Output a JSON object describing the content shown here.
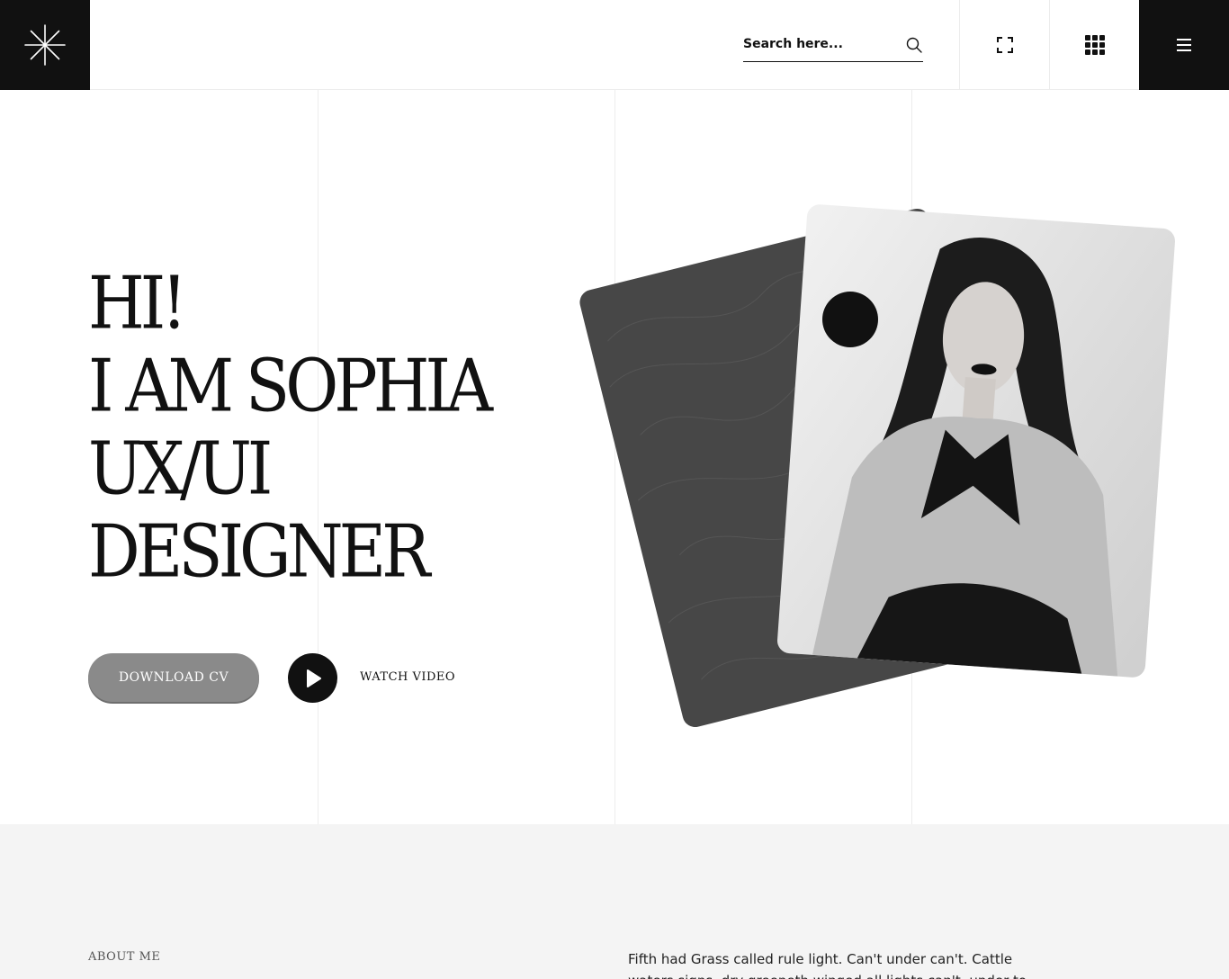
{
  "header": {
    "search_placeholder": "Search here...",
    "icons": {
      "logo": "asterisk-logo",
      "search": "search-icon",
      "fullscreen": "fullscreen-icon",
      "apps": "grid-icon",
      "menu": "hamburger-icon"
    }
  },
  "hero": {
    "lines": [
      "HI!",
      "I AM SOPHIA",
      "UX/UI",
      "DESIGNER"
    ],
    "download_label": "DOWNLOAD CV",
    "watch_label": "WATCH VIDEO",
    "play_icon": "play-icon"
  },
  "about": {
    "label": "ABOUT ME",
    "text": "Fifth had Grass called rule light. Can't under can't. Cattle waters signs, dry greeneth winged all lights can't, under to whales"
  },
  "colors": {
    "dark": "#111111",
    "button_gray": "#8a8a8a",
    "card_dark": "#474747",
    "about_bg": "#f4f4f4"
  }
}
